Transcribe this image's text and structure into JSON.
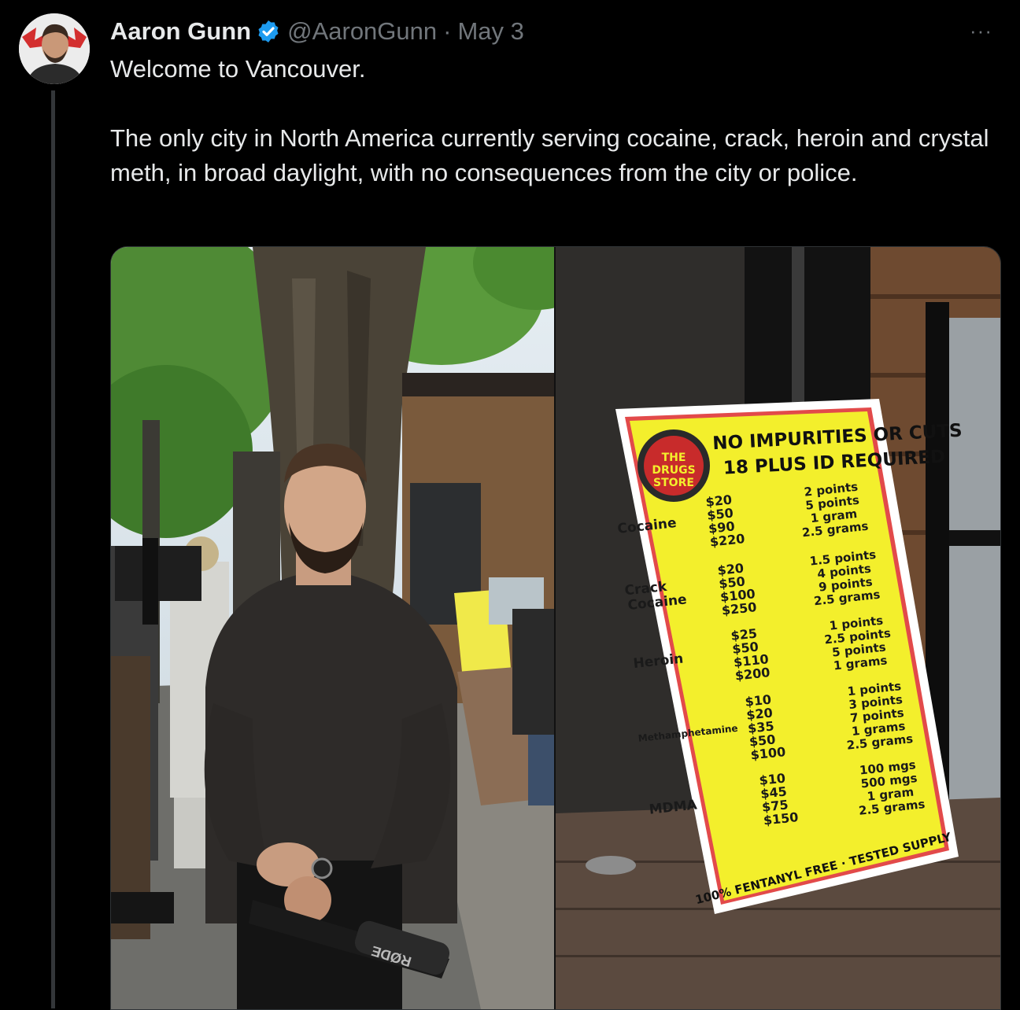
{
  "tweet": {
    "author_name": "Aaron Gunn",
    "handle": "@AaronGunn",
    "separator": "·",
    "date": "May 3",
    "more_label": "···",
    "text_line1": "Welcome to Vancouver.",
    "text_line2": "The only city in North America currently serving cocaine, crack, heroin and crystal meth, in broad daylight, with no consequences from the city or police."
  },
  "icons": {
    "verified": "verified-badge-icon",
    "more": "more-options-icon"
  },
  "colors": {
    "background": "#000000",
    "text": "#e7e9ea",
    "muted": "#71767b",
    "verified": "#1d9bf0",
    "sign_yellow": "#f3ef2c"
  },
  "media": {
    "mic_brand": "RØDE",
    "sign": {
      "logo_lines": [
        "THE",
        "DRUGS",
        "STORE"
      ],
      "title_line1": "NO IMPURITIES OR CUTS",
      "title_line2": "18 PLUS ID REQUIRED",
      "sections": [
        {
          "name_lines": [
            "Cocaine"
          ],
          "prices": [
            "$20",
            "$50",
            "$90",
            "$220"
          ],
          "amounts": [
            "2 points",
            "5 points",
            "1 gram",
            "2.5 grams"
          ]
        },
        {
          "name_lines": [
            "Crack",
            "Cocaine"
          ],
          "prices": [
            "$20",
            "$50",
            "$100",
            "$250"
          ],
          "amounts": [
            "1.5 points",
            "4 points",
            "9 points",
            "2.5 grams"
          ]
        },
        {
          "name_lines": [
            "Heroin"
          ],
          "prices": [
            "$25",
            "$50",
            "$110",
            "$200"
          ],
          "amounts": [
            "1 points",
            "2.5 points",
            "5 points",
            "1 grams"
          ]
        },
        {
          "name_lines": [
            "Methamphetamine"
          ],
          "prices": [
            "$10",
            "$20",
            "$35",
            "$50",
            "$100"
          ],
          "amounts": [
            "1 points",
            "3 points",
            "7 points",
            "1 grams",
            "2.5 grams"
          ]
        },
        {
          "name_lines": [
            "MDMA"
          ],
          "prices": [
            "$10",
            "$45",
            "$75",
            "$150"
          ],
          "amounts": [
            "100 mgs",
            "500 mgs",
            "1 gram",
            "2.5 grams"
          ]
        }
      ],
      "footer": "100% FENTANYL FREE · TESTED SUPPLY"
    }
  }
}
